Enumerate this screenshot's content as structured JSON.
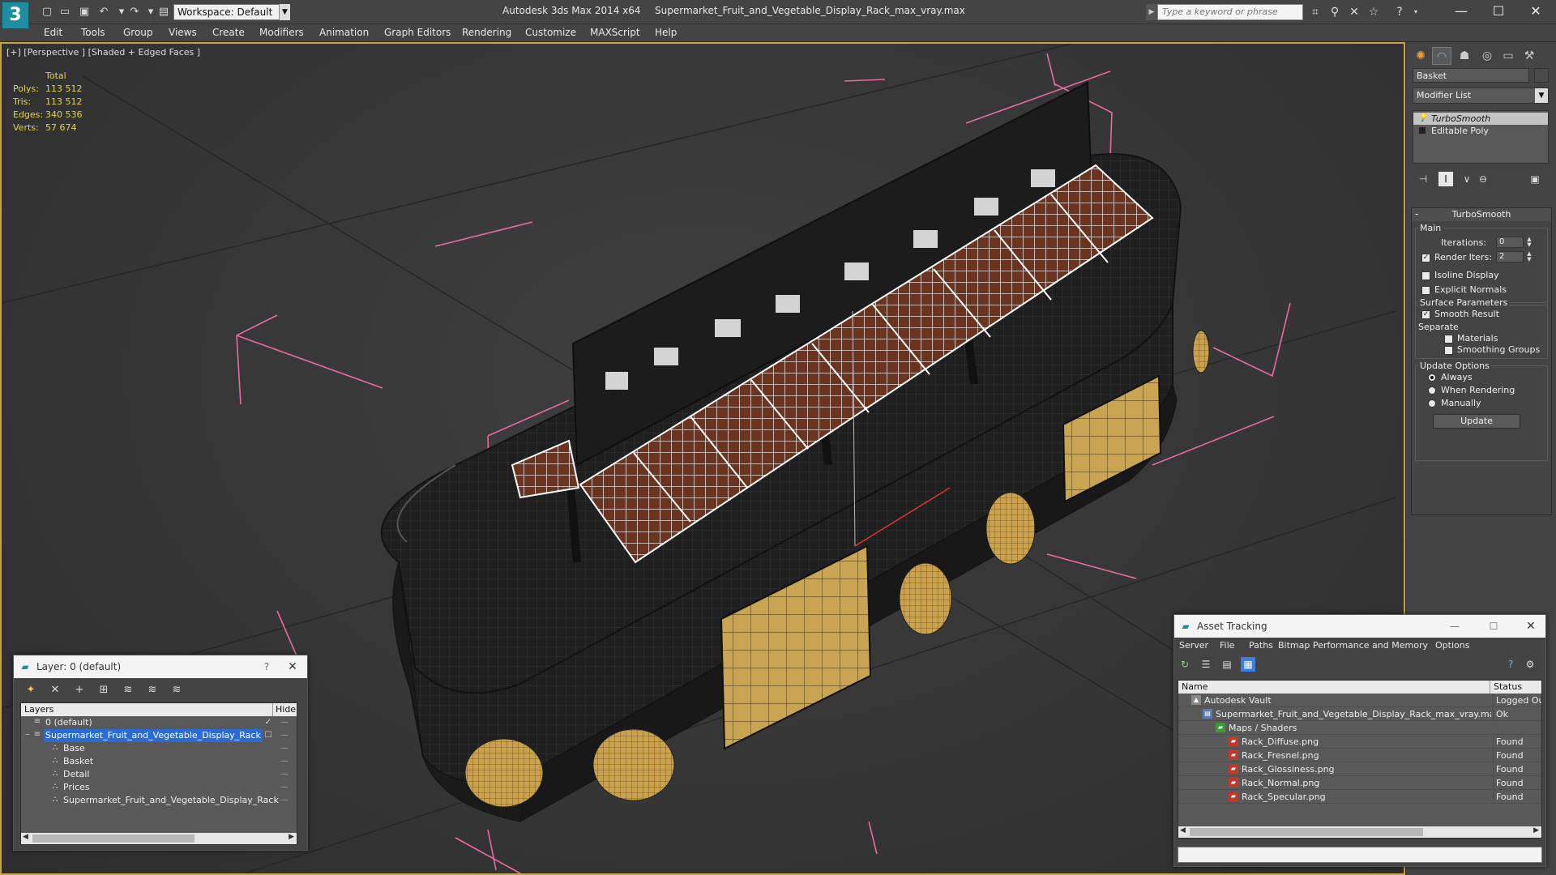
{
  "app": {
    "logo": "3",
    "title": "Autodesk 3ds Max 2014 x64",
    "file": "Supermarket_Fruit_and_Vegetable_Display_Rack_max_vray.max",
    "workspace": "Workspace: Default",
    "search_placeholder": "Type a keyword or phrase"
  },
  "menu": [
    "Edit",
    "Tools",
    "Group",
    "Views",
    "Create",
    "Modifiers",
    "Animation",
    "Graph Editors",
    "Rendering",
    "Customize",
    "MAXScript",
    "Help"
  ],
  "viewport": {
    "label": "[+] [Perspective ] [Shaded + Edged Faces ]",
    "stats": {
      "header": "Total",
      "rows": [
        {
          "label": "Polys:",
          "value": "113 512"
        },
        {
          "label": "Tris:",
          "value": "113 512"
        },
        {
          "label": "Edges:",
          "value": "340 536"
        },
        {
          "label": "Verts:",
          "value": "57 674"
        }
      ]
    }
  },
  "command_panel": {
    "object_name": "Basket",
    "modifier_list": "Modifier List",
    "stack": [
      "TurboSmooth",
      "Editable Poly"
    ],
    "rollout_title": "TurboSmooth",
    "main_label": "Main",
    "iterations_label": "Iterations:",
    "iterations_value": "0",
    "render_iters_label": "Render Iters:",
    "render_iters_value": "2",
    "isoline_label": "Isoline Display",
    "explicit_normals_label": "Explicit Normals",
    "surface_label": "Surface Parameters",
    "smooth_result_label": "Smooth Result",
    "separate_label": "Separate",
    "materials_label": "Materials",
    "smoothing_groups_label": "Smoothing Groups",
    "update_options_label": "Update Options",
    "always_label": "Always",
    "when_rendering_label": "When Rendering",
    "manually_label": "Manually",
    "update_button": "Update"
  },
  "layer_dialog": {
    "title": "Layer: 0 (default)",
    "help": "?",
    "col_layers": "Layers",
    "col_hide": "Hide",
    "rows": [
      {
        "name": "0 (default)",
        "indent": 0
      },
      {
        "name": "Supermarket_Fruit_and_Vegetable_Display_Rack",
        "indent": 0
      },
      {
        "name": "Base",
        "indent": 1
      },
      {
        "name": "Basket",
        "indent": 1
      },
      {
        "name": "Detail",
        "indent": 1
      },
      {
        "name": "Prices",
        "indent": 1
      },
      {
        "name": "Supermarket_Fruit_and_Vegetable_Display_Rack",
        "indent": 1
      }
    ]
  },
  "asset_dialog": {
    "title": "Asset Tracking",
    "menu": [
      "Server",
      "File",
      "Paths",
      "Bitmap Performance and Memory",
      "Options"
    ],
    "col_name": "Name",
    "col_status": "Status",
    "rows": [
      {
        "name": "Autodesk Vault",
        "status": "Logged Out",
        "indent": 0,
        "icon": "vault"
      },
      {
        "name": "Supermarket_Fruit_and_Vegetable_Display_Rack_max_vray.max",
        "status": "Ok",
        "indent": 1,
        "icon": "max"
      },
      {
        "name": "Maps / Shaders",
        "status": "",
        "indent": 2,
        "icon": "maps"
      },
      {
        "name": "Rack_Diffuse.png",
        "status": "Found",
        "indent": 3,
        "icon": "png"
      },
      {
        "name": "Rack_Fresnel.png",
        "status": "Found",
        "indent": 3,
        "icon": "png"
      },
      {
        "name": "Rack_Glossiness.png",
        "status": "Found",
        "indent": 3,
        "icon": "png"
      },
      {
        "name": "Rack_Normal.png",
        "status": "Found",
        "indent": 3,
        "icon": "png"
      },
      {
        "name": "Rack_Specular.png",
        "status": "Found",
        "indent": 3,
        "icon": "png"
      }
    ]
  },
  "colors": {
    "viewport_border": "#c8a447",
    "stats_text": "#e6d24a",
    "selection": "#2a6bd8",
    "rack_body": "#1f1f1f",
    "panel_gold": "#c9a452",
    "wireframe": "#ffffff",
    "basket_fill": "#6b3420",
    "gizmo_pink": "#e86aa2"
  }
}
